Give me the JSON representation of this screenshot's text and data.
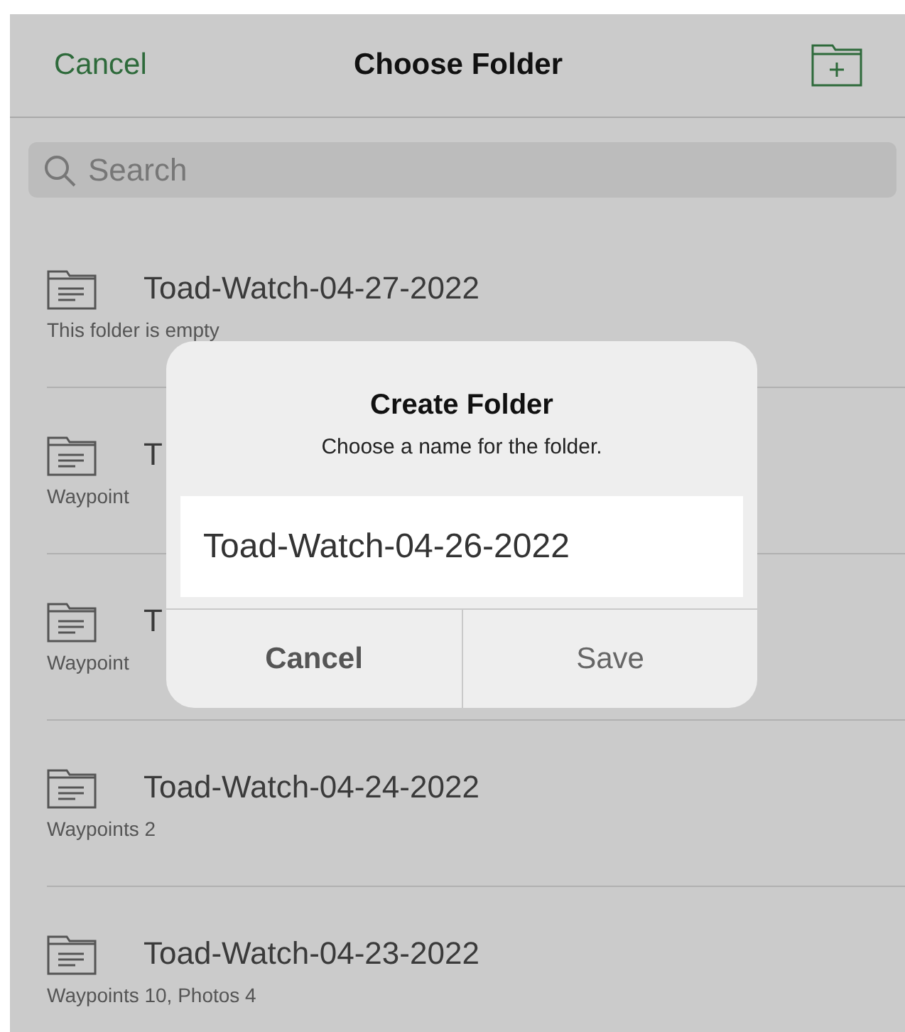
{
  "header": {
    "cancel": "Cancel",
    "title": "Choose Folder"
  },
  "search": {
    "placeholder": "Search"
  },
  "folders": [
    {
      "name": "Toad-Watch-04-27-2022",
      "subtitle": "This folder is empty"
    },
    {
      "name": "T",
      "subtitle": "Waypoint"
    },
    {
      "name": "T",
      "subtitle": "Waypoint"
    },
    {
      "name": "Toad-Watch-04-24-2022",
      "subtitle": "Waypoints 2"
    },
    {
      "name": "Toad-Watch-04-23-2022",
      "subtitle": "Waypoints 10, Photos 4"
    }
  ],
  "dialog": {
    "title": "Create Folder",
    "message": "Choose a name for the folder.",
    "value": "Toad-Watch-04-26-2022",
    "buttons": [
      {
        "label": "Cancel",
        "kind": "cancel"
      },
      {
        "label": "Save",
        "kind": "save"
      }
    ]
  }
}
